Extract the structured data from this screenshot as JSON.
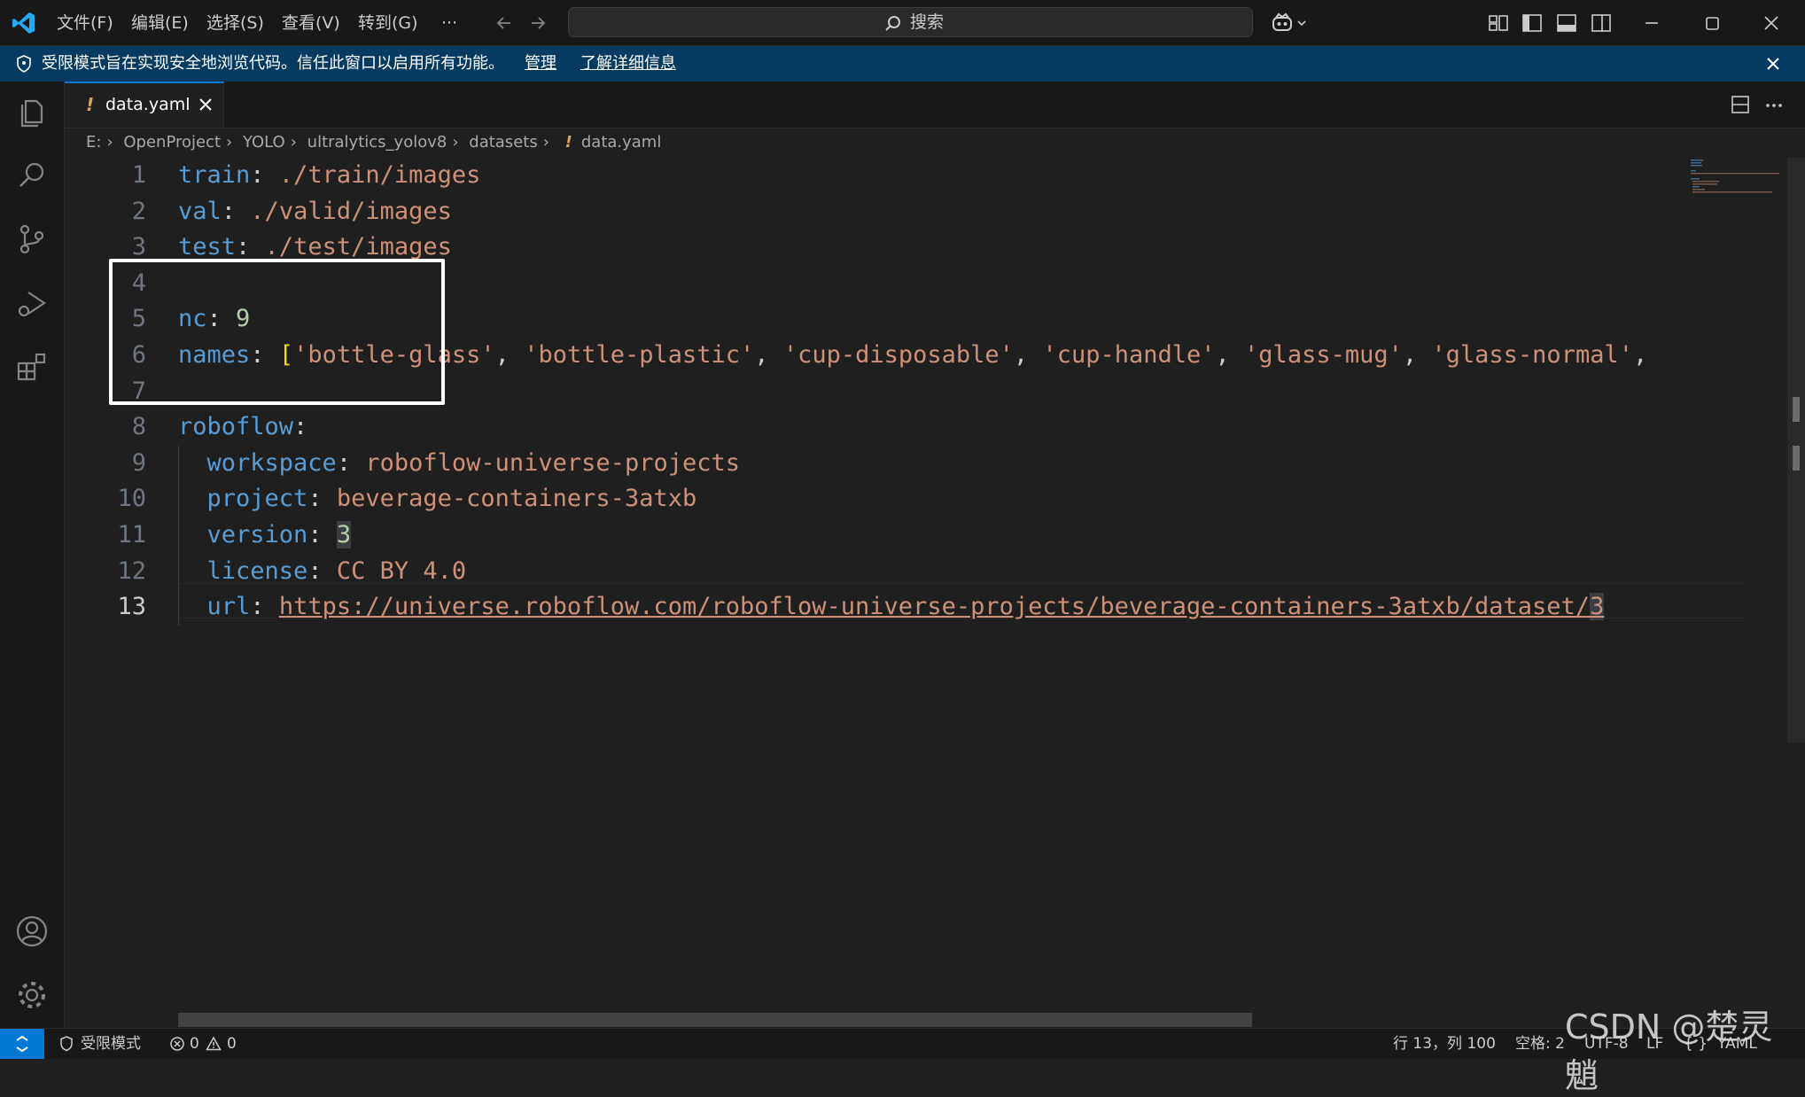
{
  "titlebar": {
    "menus": [
      "文件(F)",
      "编辑(E)",
      "选择(S)",
      "查看(V)",
      "转到(G)",
      "···"
    ],
    "search_label": "搜索"
  },
  "banner": {
    "message": "受限模式旨在实现安全地浏览代码。信任此窗口以启用所有功能。",
    "manage_link": "管理",
    "learn_more_link": "了解详细信息"
  },
  "tab": {
    "file_marker": "!",
    "filename": "data.yaml"
  },
  "breadcrumb": {
    "items": [
      "E:",
      "OpenProject",
      "YOLO",
      "ultralytics_yolov8",
      "datasets"
    ],
    "file_marker": "!",
    "file": "data.yaml"
  },
  "editor": {
    "line_numbers": [
      "1",
      "2",
      "3",
      "4",
      "5",
      "6",
      "7",
      "8",
      "9",
      "10",
      "11",
      "12",
      "13"
    ],
    "active_line": 13,
    "lines": {
      "l1": {
        "key": "train",
        "colon": ":",
        "value": " ./train/images"
      },
      "l2": {
        "key": "val",
        "colon": ":",
        "value": " ./valid/images"
      },
      "l3": {
        "key": "test",
        "colon": ":",
        "value": " ./test/images"
      },
      "l5": {
        "key": "nc",
        "colon": ":",
        "value": "9"
      },
      "l6": {
        "key": "names",
        "colon": ":",
        "open_bracket": "[",
        "items": [
          "'bottle-glass'",
          "'bottle-plastic'",
          "'cup-disposable'",
          "'cup-handle'",
          "'glass-mug'",
          "'glass-normal'"
        ],
        "comma": ","
      },
      "l8": {
        "key": "roboflow",
        "colon": ":"
      },
      "l9": {
        "key": "workspace",
        "colon": ":",
        "value": " roboflow-universe-projects"
      },
      "l10": {
        "key": "project",
        "colon": ":",
        "value": " beverage-containers-3atxb"
      },
      "l11": {
        "key": "version",
        "colon": ":",
        "value": "3"
      },
      "l12": {
        "key": "license",
        "colon": ":",
        "value": " CC BY 4.0"
      },
      "l13": {
        "key": "url",
        "colon": ":",
        "value": "https://universe.roboflow.com/roboflow-universe-projects/beverage-containers-3atxb/dataset/",
        "value_last_char": "3"
      }
    }
  },
  "statusbar": {
    "restricted_mode": "受限模式",
    "errors": "0",
    "warnings": "0",
    "cursor_position": "行 13，列 100",
    "spaces": "空格: 2",
    "encoding": "UTF-8",
    "eol": "LF",
    "language_braces": "{ }",
    "language": "YAML"
  },
  "watermark": "CSDN @楚灵魈",
  "colors": {
    "accent": "#0078d4",
    "banner": "#063b61",
    "keyword": "#569cd6",
    "string": "#ce9178",
    "number": "#b5cea8",
    "bracket": "#ffd700"
  }
}
